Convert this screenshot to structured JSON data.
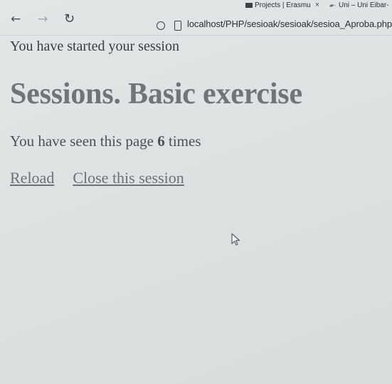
{
  "browser": {
    "tabs": [
      {
        "label": "Projects | Erasmu",
        "close_glyph": "×"
      },
      {
        "label": "Uni – Uni Eibar-",
        "icon": "eu-flag-icon"
      }
    ],
    "nav": {
      "back_glyph": "←",
      "forward_glyph": "→",
      "reload_glyph": "↻"
    },
    "url": "localhost/PHP/sesioak/sesioak/sesioa_Aproba.php"
  },
  "page": {
    "started_text": "You have started your session",
    "heading": "Sessions. Basic exercise",
    "seen_prefix": "You have seen this page ",
    "seen_count": "6",
    "seen_suffix": " times",
    "links": {
      "reload": "Reload",
      "close": "Close this session"
    }
  }
}
